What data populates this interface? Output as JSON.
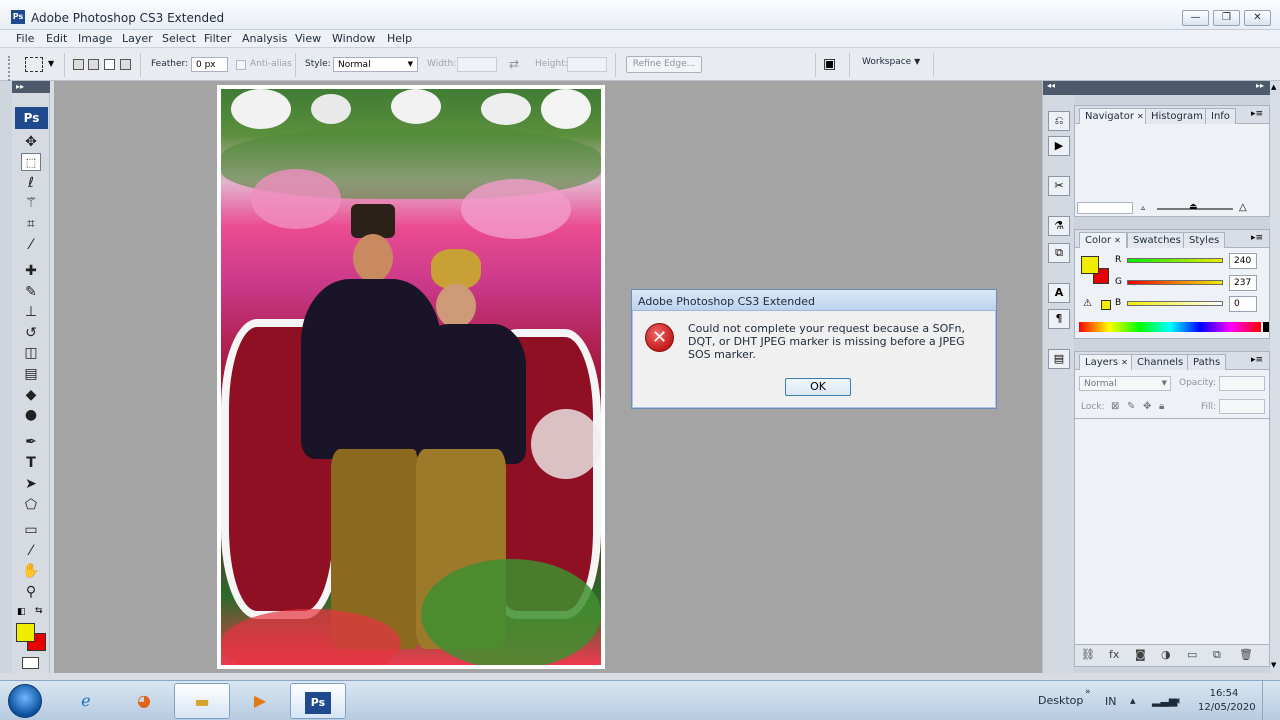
{
  "window": {
    "title": "Adobe Photoshop CS3 Extended",
    "logo_text": "Ps",
    "controls": [
      "minimize",
      "restore",
      "close"
    ]
  },
  "menu": [
    "File",
    "Edit",
    "Image",
    "Layer",
    "Select",
    "Filter",
    "Analysis",
    "View",
    "Window",
    "Help"
  ],
  "options_bar": {
    "feather_label": "Feather:",
    "feather_value": "0 px",
    "antialias_label": "Anti-alias",
    "style_label": "Style:",
    "style_value": "Normal",
    "width_label": "Width:",
    "height_label": "Height:",
    "refine_edge_label": "Refine Edge...",
    "workspace_label": "Workspace"
  },
  "toolbox": {
    "logo_text": "Ps",
    "tools": [
      "move-tool",
      "marquee-tool",
      "lasso-tool",
      "magic-wand-tool",
      "crop-tool",
      "slice-tool",
      "healing-brush-tool",
      "brush-tool",
      "clone-stamp-tool",
      "history-brush-tool",
      "eraser-tool",
      "gradient-tool",
      "blur-tool",
      "dodge-tool",
      "pen-tool",
      "type-tool",
      "path-selection-tool",
      "shape-tool",
      "notes-tool",
      "eyedropper-tool",
      "hand-tool",
      "zoom-tool"
    ],
    "foreground_color": "#f0ed00",
    "background_color": "#e60000"
  },
  "panels": {
    "navigator_tabs": [
      "Navigator",
      "Histogram",
      "Info"
    ],
    "color_tabs": [
      "Color",
      "Swatches",
      "Styles"
    ],
    "color": {
      "r_label": "R",
      "g_label": "G",
      "b_label": "B",
      "r": "240",
      "g": "237",
      "b": "0"
    },
    "layers_tabs": [
      "Layers",
      "Channels",
      "Paths"
    ],
    "layers": {
      "blend_mode": "Normal",
      "opacity_label": "Opacity:",
      "lock_label": "Lock:",
      "fill_label": "Fill:"
    }
  },
  "dialog": {
    "title": "Adobe Photoshop CS3 Extended",
    "message": "Could not complete your request because a SOFn, DQT, or DHT JPEG marker is missing before a JPEG SOS marker.",
    "ok_label": "OK",
    "icon": "error-icon"
  },
  "taskbar": {
    "items": [
      "internet-explorer-icon",
      "firefox-icon",
      "file-explorer-icon",
      "media-player-icon",
      "photoshop-icon"
    ],
    "photoshop_label": "Ps",
    "desktop_label": "Desktop",
    "language": "IN",
    "time": "16:54",
    "date": "12/05/2020"
  }
}
